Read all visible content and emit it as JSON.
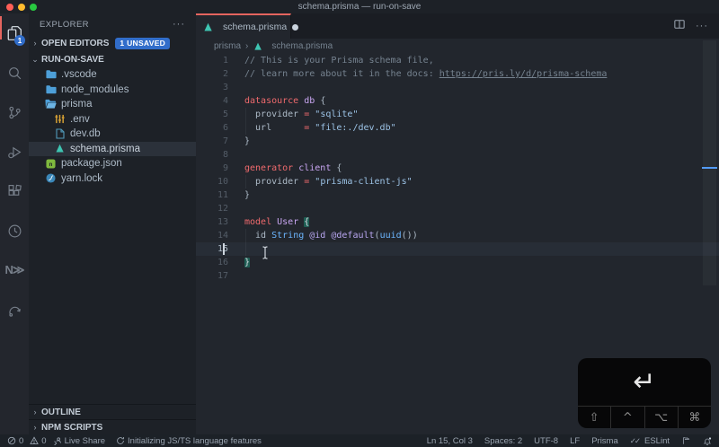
{
  "window": {
    "title": "schema.prisma — run-on-save"
  },
  "colors": {
    "accent_tab_border": "#e5655f",
    "badge_blue": "#316dca",
    "keyword": "#f06a6d",
    "type_name": "#c9a6f2",
    "string": "#9cc3e6",
    "comment": "#768390",
    "prisma_teal": "#3ec5b2",
    "overview_cursor_marker": "#539bf5"
  },
  "activity_bar": {
    "items": [
      {
        "name": "explorer",
        "icon": "files-icon",
        "active": true,
        "badge": "1"
      },
      {
        "name": "search",
        "icon": "search-icon"
      },
      {
        "name": "source-control",
        "icon": "source-control-icon"
      },
      {
        "name": "run-debug",
        "icon": "run-debug-icon"
      },
      {
        "name": "extensions",
        "icon": "extensions-icon"
      },
      {
        "name": "clock-extension",
        "icon": "clock-icon"
      },
      {
        "name": "letter-n-extension",
        "icon": "letter-n-icon",
        "text": "N≫"
      },
      {
        "name": "swirl-extension",
        "icon": "swirl-icon"
      }
    ]
  },
  "sidebar": {
    "title": "EXPLORER",
    "more_label": "···",
    "open_editors": {
      "label": "OPEN EDITORS",
      "badge": "1 UNSAVED",
      "chevron": "›"
    },
    "root": {
      "label": "RUN-ON-SAVE",
      "chevron": "⌄"
    },
    "files": [
      {
        "label": ".vscode",
        "icon": "folder-icon",
        "indent": 1
      },
      {
        "label": "node_modules",
        "icon": "folder-icon",
        "indent": 1
      },
      {
        "label": "prisma",
        "icon": "folder-open-icon",
        "indent": 1
      },
      {
        "label": ".env",
        "icon": "env-icon",
        "indent": 2
      },
      {
        "label": "dev.db",
        "icon": "file-icon",
        "indent": 2
      },
      {
        "label": "schema.prisma",
        "icon": "prisma-icon",
        "indent": 2,
        "selected": true
      },
      {
        "label": "package.json",
        "icon": "npm-icon",
        "indent": 1
      },
      {
        "label": "yarn.lock",
        "icon": "yarn-icon",
        "indent": 1
      }
    ],
    "bottom_sections": [
      {
        "label": "OUTLINE",
        "chevron": "›"
      },
      {
        "label": "NPM SCRIPTS",
        "chevron": "›"
      }
    ]
  },
  "editor": {
    "tab": {
      "label": "schema.prisma",
      "modified": true
    },
    "breadcrumb": {
      "folder": "prisma",
      "separator": "›",
      "file": "schema.prisma"
    },
    "lines": [
      {
        "n": 1,
        "tokens": [
          [
            "// This is your Prisma schema file,",
            "comment"
          ]
        ]
      },
      {
        "n": 2,
        "tokens": [
          [
            "// learn more about it in the docs: ",
            "comment"
          ],
          [
            "https://pris.ly/d/prisma-schema",
            "link"
          ]
        ]
      },
      {
        "n": 3,
        "tokens": []
      },
      {
        "n": 4,
        "tokens": [
          [
            "datasource",
            "kw"
          ],
          [
            " ",
            "plain"
          ],
          [
            "db",
            "type"
          ],
          [
            " {",
            "plain"
          ]
        ]
      },
      {
        "n": 5,
        "tokens": [
          [
            "  provider ",
            "plain"
          ],
          [
            "=",
            "op"
          ],
          [
            " ",
            "plain"
          ],
          [
            "\"sqlite\"",
            "str"
          ]
        ]
      },
      {
        "n": 6,
        "tokens": [
          [
            "  url      ",
            "plain"
          ],
          [
            "=",
            "op"
          ],
          [
            " ",
            "plain"
          ],
          [
            "\"file:./dev.db\"",
            "str"
          ]
        ]
      },
      {
        "n": 7,
        "tokens": [
          [
            "}",
            "plain"
          ]
        ]
      },
      {
        "n": 8,
        "tokens": []
      },
      {
        "n": 9,
        "tokens": [
          [
            "generator",
            "kw"
          ],
          [
            " ",
            "plain"
          ],
          [
            "client",
            "type"
          ],
          [
            " {",
            "plain"
          ]
        ]
      },
      {
        "n": 10,
        "tokens": [
          [
            "  provider ",
            "plain"
          ],
          [
            "=",
            "op"
          ],
          [
            " ",
            "plain"
          ],
          [
            "\"prisma-client-js\"",
            "str"
          ]
        ]
      },
      {
        "n": 11,
        "tokens": [
          [
            "}",
            "plain"
          ]
        ]
      },
      {
        "n": 12,
        "tokens": []
      },
      {
        "n": 13,
        "tokens": [
          [
            "model",
            "kw"
          ],
          [
            " ",
            "plain"
          ],
          [
            "User",
            "type"
          ],
          [
            " ",
            "plain"
          ],
          [
            "{",
            "match"
          ]
        ]
      },
      {
        "n": 14,
        "tokens": [
          [
            "  id ",
            "plain"
          ],
          [
            "String",
            "blue"
          ],
          [
            " ",
            "plain"
          ],
          [
            "@id",
            "attr"
          ],
          [
            " ",
            "plain"
          ],
          [
            "@default",
            "attr"
          ],
          [
            "(",
            "plain"
          ],
          [
            "uuid",
            "blue"
          ],
          [
            "())",
            "plain"
          ]
        ]
      },
      {
        "n": 15,
        "tokens": [],
        "current": true,
        "cursor_col": 3
      },
      {
        "n": 16,
        "tokens": [
          [
            "}",
            "match"
          ]
        ]
      },
      {
        "n": 17,
        "tokens": []
      }
    ]
  },
  "status_bar": {
    "left": [
      {
        "icon": "error-icon",
        "text": "0"
      },
      {
        "icon": "warning-icon",
        "text": "0"
      },
      {
        "icon": "liveshare-icon",
        "text": "Live Share",
        "name": "live-share"
      },
      {
        "icon": "sync-icon",
        "text": "Initializing JS/TS language features",
        "name": "language-status"
      }
    ],
    "right": [
      {
        "text": "Ln 15, Col 3",
        "name": "cursor-position"
      },
      {
        "text": "Spaces: 2",
        "name": "indentation"
      },
      {
        "text": "UTF-8",
        "name": "encoding"
      },
      {
        "text": "LF",
        "name": "eol"
      },
      {
        "text": "Prisma",
        "name": "language-mode"
      },
      {
        "icon": "double-check-icon",
        "text": "ESLint",
        "name": "eslint"
      },
      {
        "icon": "flag-icon",
        "text": "",
        "name": "feedback"
      },
      {
        "icon": "bell-icon",
        "text": "",
        "name": "notifications"
      }
    ]
  },
  "key_overlay": {
    "key": "↵",
    "modifiers": [
      "⇧",
      "^",
      "⌥",
      "⌘"
    ]
  }
}
